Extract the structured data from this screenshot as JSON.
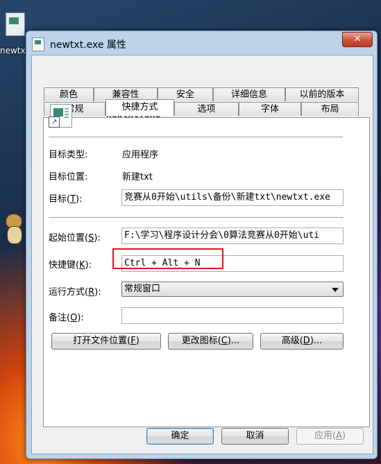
{
  "desktop": {
    "icon_label": "newtx"
  },
  "window": {
    "title": "newtxt.exe 属性",
    "close_glyph": "✕"
  },
  "tabs_row1": [
    "颜色",
    "兼容性",
    "安全",
    "详细信息",
    "以前的版本"
  ],
  "tabs_row2": [
    "常规",
    "快捷方式",
    "选项",
    "字体",
    "布局"
  ],
  "active_tab": "快捷方式",
  "shortcut": {
    "name": "newtxt.exe",
    "target_type_label": "目标类型:",
    "target_type_value": "应用程序",
    "target_location_label": "目标位置:",
    "target_location_value": "新建txt",
    "target_label_pre": "目标(",
    "target_label_key": "T",
    "target_label_post": "):",
    "target_value": "竞赛从0开始\\utils\\备份\\新建txt\\newtxt.exe",
    "start_in_label_pre": "起始位置(",
    "start_in_label_key": "S",
    "start_in_label_post": "):",
    "start_in_value": "F:\\学习\\程序设计分会\\0算法竞赛从0开始\\uti",
    "hotkey_label_pre": "快捷键(",
    "hotkey_label_key": "K",
    "hotkey_label_post": "):",
    "hotkey_value": "Ctrl + Alt + N",
    "run_label_pre": "运行方式(",
    "run_label_key": "R",
    "run_label_post": "):",
    "run_value": "常规窗口",
    "comment_label_pre": "备注(",
    "comment_label_key": "O",
    "comment_label_post": "):",
    "comment_value": ""
  },
  "actions": {
    "open_location_pre": "打开文件位置(",
    "open_location_key": "F",
    "open_location_post": ")",
    "change_icon_pre": "更改图标(",
    "change_icon_key": "C",
    "change_icon_post": ")...",
    "advanced_pre": "高级(",
    "advanced_key": "D",
    "advanced_post": ")..."
  },
  "footer": {
    "ok": "确定",
    "cancel": "取消",
    "apply_pre": "应用(",
    "apply_key": "A",
    "apply_post": ")"
  },
  "colors": {
    "highlight_box": "#e0151a",
    "titlebar": "#bcd3ea"
  }
}
